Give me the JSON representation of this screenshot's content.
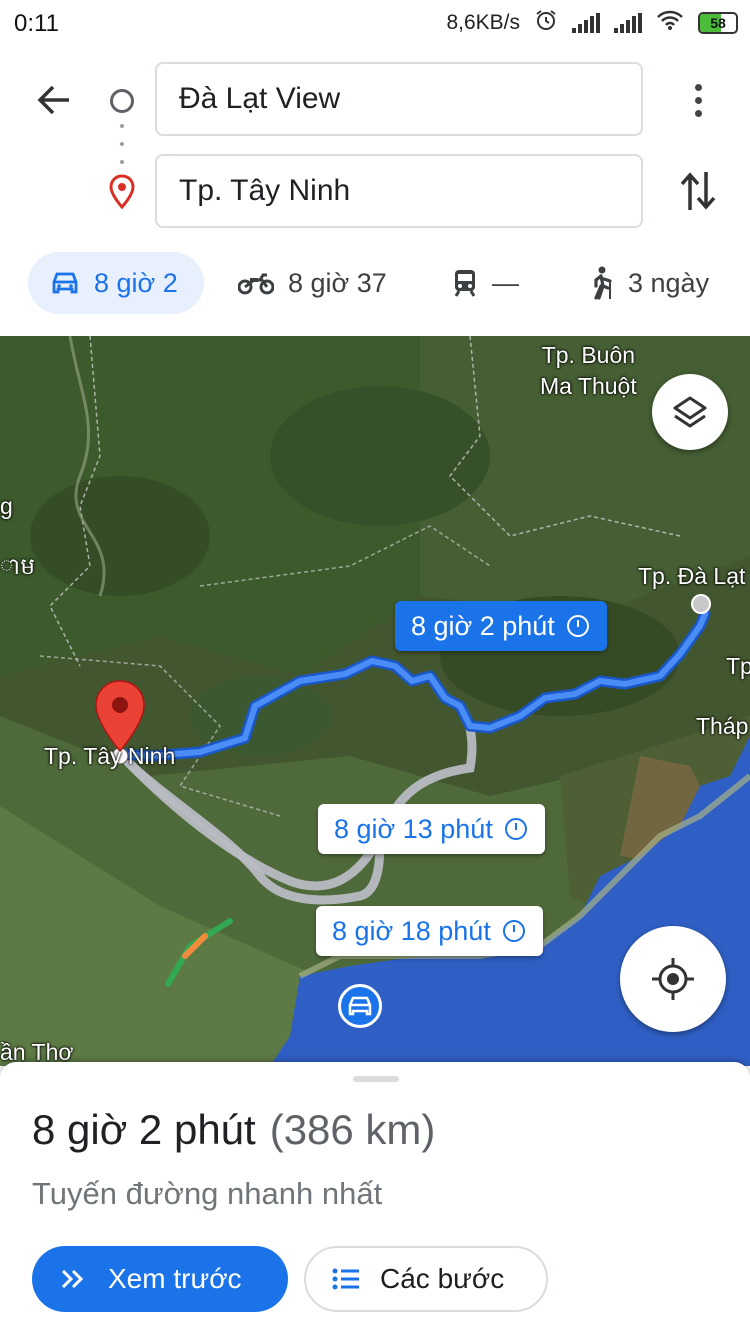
{
  "status_bar": {
    "time": "0:11",
    "net_speed": "8,6KB/s",
    "battery": "58",
    "battery_level": 0.58,
    "icons": [
      "alarm-icon",
      "signal-icon",
      "signal-icon",
      "wifi-icon",
      "battery-icon"
    ]
  },
  "search": {
    "origin": "Đà Lạt View",
    "destination": "Tp. Tây Ninh"
  },
  "modes": [
    {
      "name": "driving",
      "icon": "car-icon",
      "label": "8 giờ 2",
      "active": true
    },
    {
      "name": "motorcycle",
      "icon": "motorcycle-icon",
      "label": "8 giờ 37",
      "active": false
    },
    {
      "name": "transit",
      "icon": "train-icon",
      "label": "—",
      "active": false
    },
    {
      "name": "walking",
      "icon": "walking-icon",
      "label": "3 ngày",
      "active": false
    }
  ],
  "map": {
    "cities": [
      {
        "name": "Tp. Buôn\nMa Thuột"
      },
      {
        "name": "Tp. Đà Lạt"
      },
      {
        "name": "Tp. Tây Ninh"
      },
      {
        "name": "Tp"
      },
      {
        "name": "Tháp"
      },
      {
        "name": "g"
      },
      {
        "name": "ាម"
      },
      {
        "name": "ần Thơ"
      }
    ],
    "routes": [
      {
        "label": "8 giờ 2 phút",
        "selected": true
      },
      {
        "label": "8 giờ 13 phút",
        "selected": false
      },
      {
        "label": "8 giờ 18 phút",
        "selected": false
      }
    ],
    "colors": {
      "primary_route": "#1a73e8",
      "alt_route": "#b8bcc2",
      "sea": "#2f5fc4"
    }
  },
  "sheet": {
    "duration": "8 giờ 2 phút",
    "distance": "(386 km)",
    "subtitle": "Tuyến đường nhanh nhất",
    "preview_button": "Xem trước",
    "steps_button": "Các bước"
  }
}
